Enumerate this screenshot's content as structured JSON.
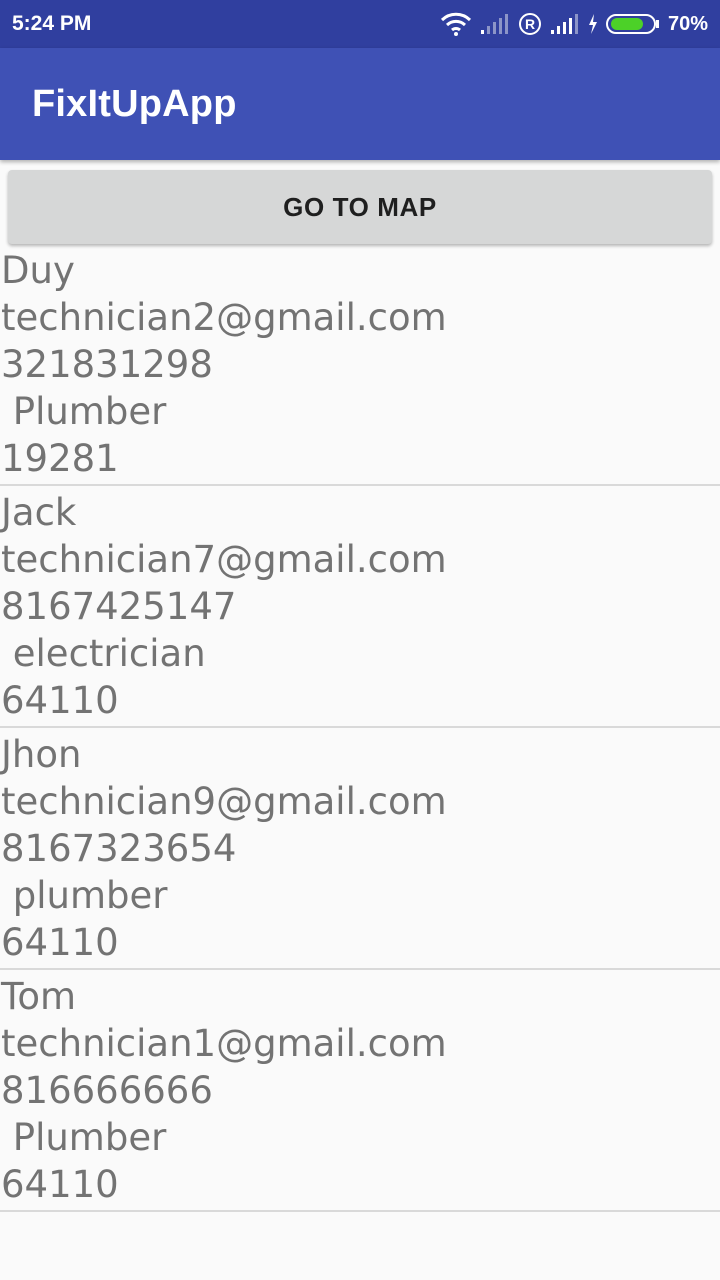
{
  "status_bar": {
    "time": "5:24 PM",
    "battery_percent": "70%",
    "icons": [
      "wifi-icon",
      "signal-weak-icon",
      "registered-icon",
      "signal-icon",
      "charging-icon",
      "battery-icon"
    ]
  },
  "app_bar": {
    "title": "FixItUpApp",
    "color": "#3f51b5",
    "status_color": "#303f9f"
  },
  "map_button": {
    "label": "GO TO MAP"
  },
  "technicians": [
    {
      "name": "Duy",
      "email": "technician2@gmail.com",
      "phone": "321831298",
      "profession": " Plumber",
      "zip": "19281"
    },
    {
      "name": "Jack",
      "email": "technician7@gmail.com",
      "phone": "8167425147",
      "profession": " electrician",
      "zip": "64110"
    },
    {
      "name": "Jhon",
      "email": "technician9@gmail.com",
      "phone": "8167323654",
      "profession": " plumber",
      "zip": "64110"
    },
    {
      "name": "Tom",
      "email": "technician1@gmail.com",
      "phone": "816666666",
      "profession": " Plumber",
      "zip": "64110"
    }
  ]
}
